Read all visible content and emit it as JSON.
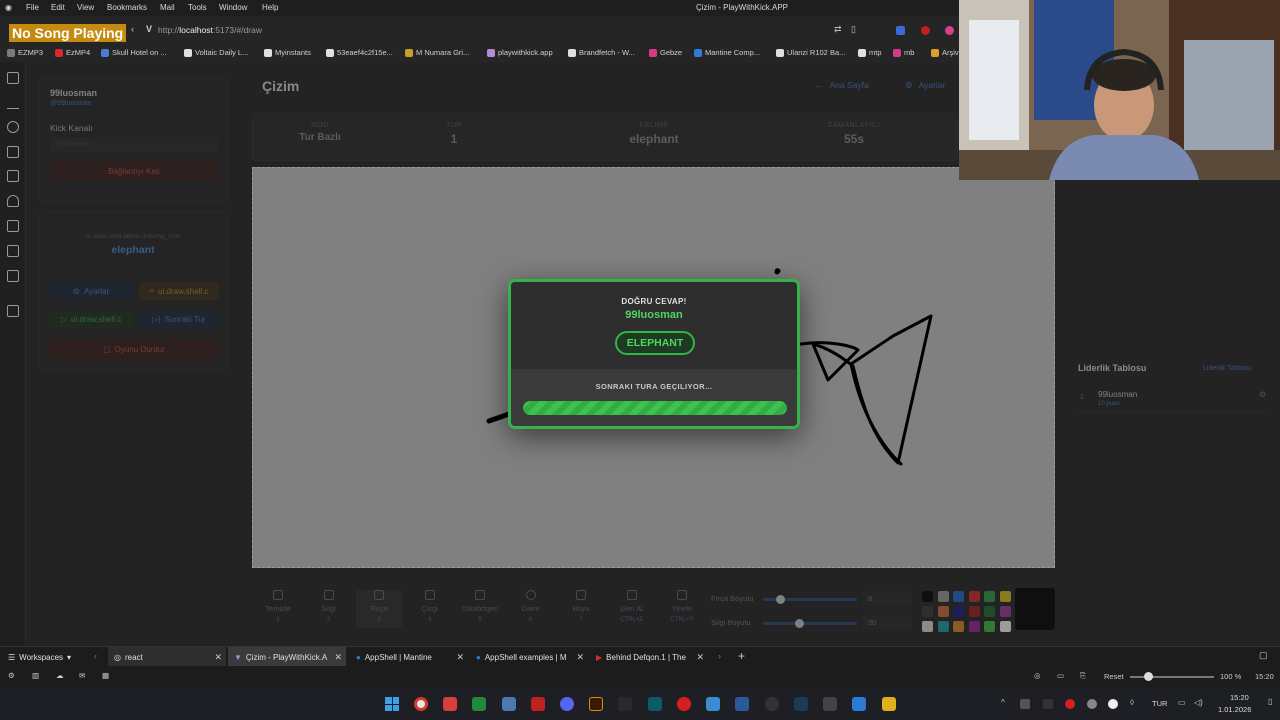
{
  "menubar": {
    "items": [
      "File",
      "Edit",
      "View",
      "Bookmarks",
      "Mail",
      "Tools",
      "Window",
      "Help"
    ],
    "window_title": "Çizim - PlayWithKick.APP"
  },
  "overlay": {
    "now_playing": "No Song Playing"
  },
  "address": {
    "url_prefix": "http://",
    "url_host": "localhost",
    "url_rest": ":5173/#/draw"
  },
  "bookmarks": [
    {
      "label": "EZMP3",
      "color": "#7a7a7a"
    },
    {
      "label": "EzMP4",
      "color": "#d62b2b"
    },
    {
      "label": "Skull Hotel on ...",
      "color": "#4a7ad6"
    },
    {
      "label": "Voltaic Daily L...",
      "color": "#e0e0e0"
    },
    {
      "label": "Myinstants",
      "color": "#e0e0e0"
    },
    {
      "label": "53eaef4c2f15e...",
      "color": "#e0e0e0"
    },
    {
      "label": "M Numara Gri...",
      "color": "#c8a028"
    },
    {
      "label": "playwithkick.app",
      "color": "#b58bd6"
    },
    {
      "label": "Brandfetch - W...",
      "color": "#e0e0e0"
    },
    {
      "label": "Gebze",
      "color": "#d63a8a"
    },
    {
      "label": "Mantine Comp...",
      "color": "#2f7ad6"
    },
    {
      "label": "Ulanzi R102 Ba...",
      "color": "#e0e0e0"
    },
    {
      "label": "mtp",
      "color": "#e0e0e0"
    },
    {
      "label": "mb",
      "color": "#d63a8a"
    },
    {
      "label": "Arşiv",
      "color": "#e0a028"
    }
  ],
  "sidebar": {
    "username": "99luosman",
    "user_sub": "@99luosman",
    "channel_label": "Kick Kanalı",
    "channel_value": "99luosman",
    "disconnect_label": "Bağlantıyı Kes",
    "drawing_now_label": "ui.draw.shell.labels.drawing_now",
    "drawing_word": "elephant",
    "settings_label": "Ayarlar",
    "shell_btn_label": "ui.draw.shell.c",
    "shell_btn2_label": "ui.draw.shell.c",
    "next_round_label": "Sonraki Tur",
    "stop_game_label": "Oyunu Durdur"
  },
  "header": {
    "title": "Çizim",
    "home_label": "Ana Sayfa",
    "settings_label": "Ayarlar"
  },
  "stats": [
    {
      "label": "MOD",
      "value": "Tur Bazlı"
    },
    {
      "label": "TUR",
      "value": "1"
    },
    {
      "label": "KELIME",
      "value": "elephant"
    },
    {
      "label": "ZAMANLAYICI",
      "value": "55s"
    }
  ],
  "modal": {
    "heading": "DOĞRU CEVAP!",
    "winner": "99luosman",
    "word_badge": "ELEPHANT",
    "next_text": "SONRAKI TURA GEÇILIYOR...",
    "progress": 1.0,
    "accent": "#36b24a"
  },
  "leaderboard": {
    "title": "Liderlik Tablosu",
    "link": "Liderlik Tablosu",
    "rows": [
      {
        "rank": "1.",
        "name": "99luosman",
        "points": "10 puan"
      }
    ]
  },
  "tools": [
    {
      "label": "Temizle",
      "key": "1",
      "icon": "trash-icon"
    },
    {
      "label": "Silgi",
      "key": "2",
      "icon": "eraser-icon"
    },
    {
      "label": "Fırça",
      "key": "3",
      "icon": "brush-icon"
    },
    {
      "label": "Çizgi",
      "key": "4",
      "icon": "line-icon"
    },
    {
      "label": "Dikdörtgen",
      "key": "5",
      "icon": "rectangle-icon"
    },
    {
      "label": "Daire",
      "key": "6",
      "icon": "circle-icon"
    },
    {
      "label": "Boya",
      "key": "7",
      "icon": "bucket-icon"
    },
    {
      "label": "Geri Al",
      "key": "CTRL+Z",
      "icon": "undo-icon"
    },
    {
      "label": "Yinele",
      "key": "CTRL+Y",
      "icon": "redo-icon"
    }
  ],
  "brush": {
    "brush_label": "Fırça Boyutu",
    "brush_value": "8",
    "eraser_label": "Silgi Boyutu",
    "eraser_value": "20"
  },
  "palette": [
    "#000000",
    "#9e9e9e",
    "#1c6dd0",
    "#d62b2b",
    "#2fa04a",
    "#e0c020",
    "#3a3a3a",
    "#d06a3a",
    "#1a1a8a",
    "#a02020",
    "#1e6a2e",
    "#a03aa0",
    "#e0e0e0",
    "#20a0b0",
    "#e08a20",
    "#a020a0",
    "#40c040",
    "#ffffff"
  ],
  "tabs": {
    "workspaces_label": "Workspaces",
    "items": [
      {
        "label": "react"
      },
      {
        "label": "Çizim - PlayWithKick.A"
      },
      {
        "label": "AppShell | Mantine"
      },
      {
        "label": "AppShell examples | M"
      },
      {
        "label": "Behind Defqon.1 | The"
      }
    ]
  },
  "status": {
    "reset_label": "Reset",
    "zoom": "100 %",
    "time": "15:20"
  },
  "taskbar": {
    "lang": "TUR",
    "time": "15:20",
    "date": "1.01.2026"
  }
}
